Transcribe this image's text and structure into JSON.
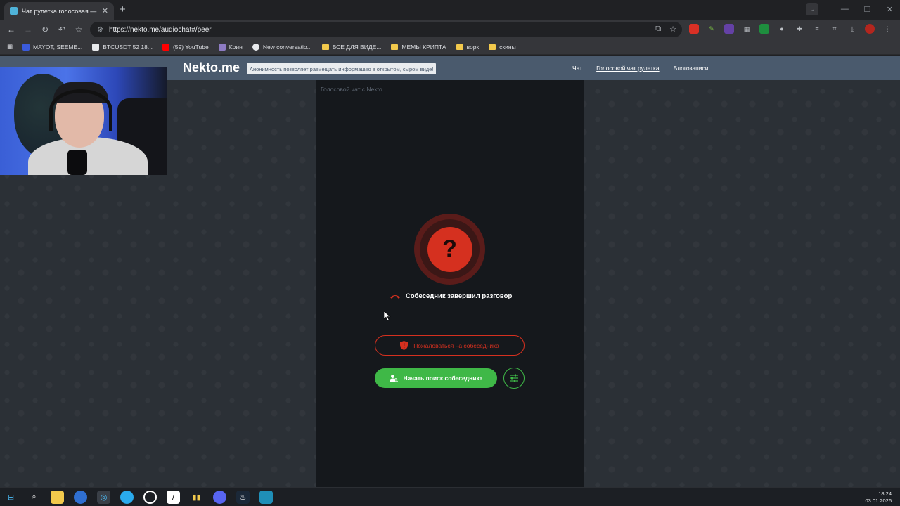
{
  "browser": {
    "tab_title": "Чат рулетка голосовая — Nekto.me",
    "url": "https://nekto.me/audiochat#/peer",
    "bookmarks": [
      {
        "label": "MAYOT, SEEME...",
        "color": "#3b5bdb"
      },
      {
        "label": "BTCUSDT 52 18...",
        "color": "#e8eaed"
      },
      {
        "label": "(59) YouTube",
        "color": "#ff0000"
      },
      {
        "label": "Коин",
        "color": "#8e7cc3"
      },
      {
        "label": "New conversatio...",
        "color": "#e8eaed"
      },
      {
        "label": "ВСЕ ДЛЯ ВИДЕ...",
        "color": "#f2c94c"
      },
      {
        "label": "МЕМЫ КРИПТА",
        "color": "#f2c94c"
      },
      {
        "label": "ворк",
        "color": "#f2c94c"
      },
      {
        "label": "скины",
        "color": "#f2c94c"
      }
    ]
  },
  "site": {
    "logo": "Nekto.me",
    "motto": "Анонимность позволяет размещать информацию в открытом, сыром виде!",
    "menu": {
      "chat": "Чат",
      "voice_roulette": "Голосовой чат рулетка",
      "blog": "Блогозаписи"
    }
  },
  "chat": {
    "header": "Голосовой чат с Nekto",
    "avatar_glyph": "?",
    "status": "Собеседник завершил разговор",
    "report_label": "Пожаловаться на собеседника",
    "search_label": "Начать поиск собеседника"
  },
  "taskbar": {
    "time": "18:24",
    "date": "03.01.2026"
  },
  "colors": {
    "accent_red": "#d5301f",
    "accent_green": "#3fb847",
    "navbar": "#4a5a6d"
  }
}
